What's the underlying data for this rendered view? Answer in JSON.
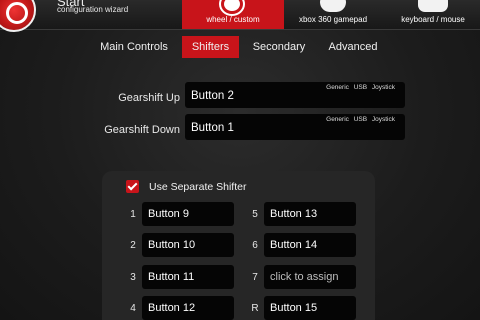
{
  "app": {
    "title": "Start",
    "subtitle": "configuration wizard"
  },
  "device_tabs": [
    {
      "label": "wheel / custom",
      "icon": "steering-wheel-icon",
      "active": true
    },
    {
      "label": "xbox 360 gamepad",
      "icon": "gamepad-icon",
      "active": false
    },
    {
      "label": "keyboard / mouse",
      "icon": "keyboard-icon",
      "active": false
    }
  ],
  "sub_tabs": [
    {
      "label": "Main Controls",
      "active": false
    },
    {
      "label": "Shifters",
      "active": true
    },
    {
      "label": "Secondary",
      "active": false
    },
    {
      "label": "Advanced",
      "active": false
    }
  ],
  "gearshift": {
    "up": {
      "label": "Gearshift Up",
      "value": "Button 2",
      "device": "Generic   USB  Joystick"
    },
    "down": {
      "label": "Gearshift Down",
      "value": "Button 1",
      "device": "Generic   USB  Joystick"
    }
  },
  "separate_shifter": {
    "label": "Use Separate Shifter",
    "checked": true
  },
  "gears": [
    {
      "num": "1",
      "value": "Button 9"
    },
    {
      "num": "2",
      "value": "Button 10"
    },
    {
      "num": "3",
      "value": "Button 11"
    },
    {
      "num": "4",
      "value": "Button 12"
    },
    {
      "num": "5",
      "value": "Button 13"
    },
    {
      "num": "6",
      "value": "Button 14"
    },
    {
      "num": "7",
      "value": "click to assign"
    },
    {
      "num": "R",
      "value": "Button 15"
    }
  ],
  "colors": {
    "accent": "#c8141a",
    "field_bg": "#050505",
    "panel_bg": "#262626"
  }
}
